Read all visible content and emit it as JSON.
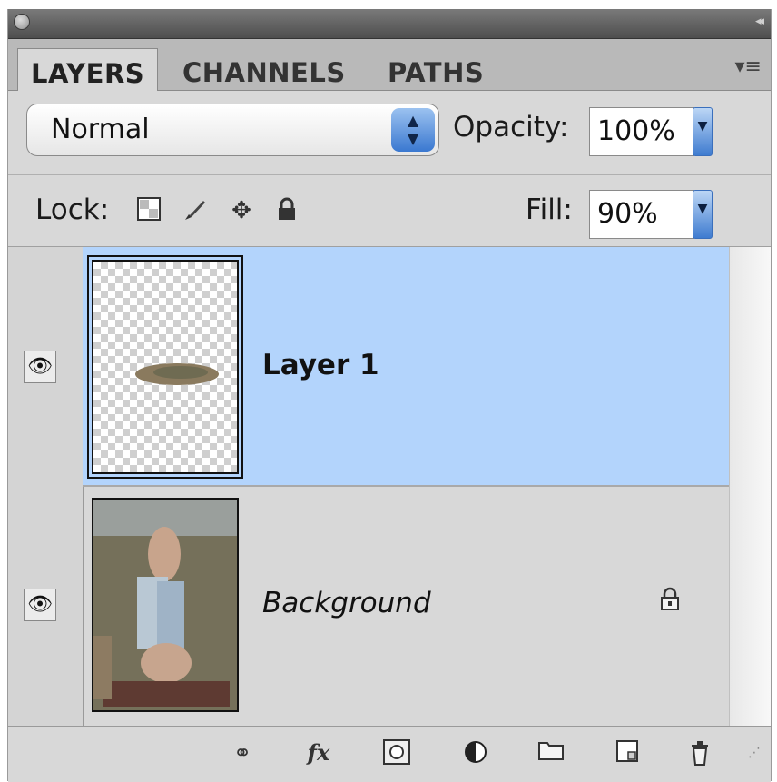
{
  "tabs": [
    {
      "label": "LAYERS",
      "active": true
    },
    {
      "label": "CHANNELS",
      "active": false
    },
    {
      "label": "PATHS",
      "active": false
    }
  ],
  "blend_mode": {
    "value": "Normal"
  },
  "opacity": {
    "label": "Opacity:",
    "value": "100%"
  },
  "lock": {
    "label": "Lock:"
  },
  "fill": {
    "label": "Fill:",
    "value": "90%"
  },
  "layers": [
    {
      "name": "Layer 1",
      "selected": true,
      "visible": true,
      "locked": false
    },
    {
      "name": "Background",
      "selected": false,
      "visible": true,
      "locked": true
    }
  ],
  "footer_icons": [
    "link-layers-icon",
    "fx-icon",
    "layer-mask-icon",
    "adjustment-layer-icon",
    "new-group-icon",
    "new-layer-icon",
    "trash-icon"
  ],
  "colors": {
    "selection": "#b3d4fc",
    "panel": "#d8d8d8",
    "accent": "#3f7cd0"
  }
}
